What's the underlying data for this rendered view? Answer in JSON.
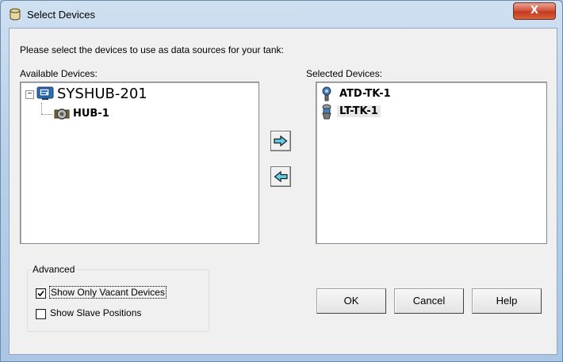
{
  "window": {
    "title": "Select Devices",
    "close_glyph": "X",
    "icon": "database-icon"
  },
  "instruction": "Please select the devices to use as data sources for your tank:",
  "available": {
    "label": "Available Devices:",
    "tree": {
      "root": {
        "label": "SYSHUB-201",
        "expander": "−",
        "icon": "system-hub-icon"
      },
      "children": [
        {
          "label": "HUB-1",
          "icon": "hub-device-icon"
        }
      ]
    }
  },
  "selected": {
    "label": "Selected Devices:",
    "items": [
      {
        "label": "ATD-TK-1",
        "icon": "temperature-sensor-icon"
      },
      {
        "label": "LT-TK-1",
        "icon": "level-transmitter-icon"
      }
    ]
  },
  "arrows": {
    "add": "arrow-right-icon",
    "remove": "arrow-left-icon"
  },
  "advanced": {
    "title": "Advanced",
    "options": [
      {
        "label": "Show Only Vacant Devices",
        "checked": true
      },
      {
        "label": "Show Slave Positions",
        "checked": false
      }
    ]
  },
  "buttons": {
    "ok": "OK",
    "cancel": "Cancel",
    "help": "Help"
  },
  "colors": {
    "arrow_fill": "#5ed2e8",
    "title_close": "#c53a1f"
  }
}
